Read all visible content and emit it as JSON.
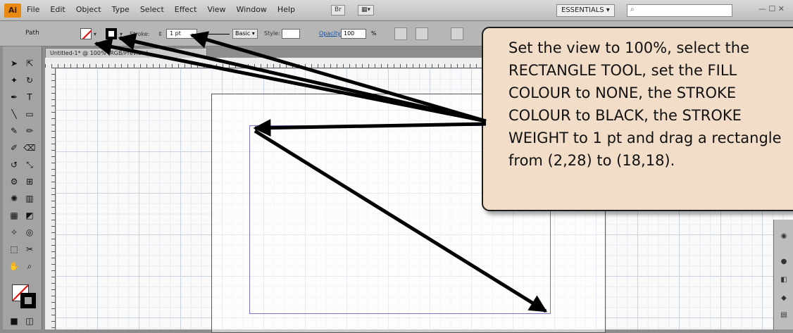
{
  "menu": {
    "items": [
      "File",
      "Edit",
      "Object",
      "Type",
      "Select",
      "Effect",
      "View",
      "Window",
      "Help"
    ],
    "mode_box": "Br",
    "arrange_box": "▦▾",
    "workspace": "ESSENTIALS ▾",
    "window_controls": "— ☐ ✕"
  },
  "control_bar": {
    "selection_label": "Path",
    "stroke_label": "Stroke:",
    "stroke_weight": "1 pt",
    "brush_definition": "Basic ▾",
    "style_label": "Style:",
    "opacity_label": "Opacity:",
    "opacity_value": "100",
    "opacity_unit": "%"
  },
  "document": {
    "tab_title": "Untitled-1* @ 100% (RGB/Preview)"
  },
  "callout": {
    "lines": [
      "Set the view to 100%, select the",
      "RECTANGLE TOOL, set the FILL",
      "COLOUR to NONE, the STROKE",
      "COLOUR to BLACK, the STROKE",
      "WEIGHT to 1 pt and drag a rectangle",
      "from (2,28) to (18,18)."
    ]
  },
  "colors": {
    "callout_fill": "#f2ddc8",
    "callout_border": "#1d1d1d",
    "rectangle_stroke": "#7a74c8",
    "arrow": "#000000",
    "fill_none_slash": "#e00000"
  },
  "icons": {
    "fill_swatch": "fill-none-swatch-icon",
    "stroke_swatch": "stroke-black-swatch-icon",
    "app_logo": "illustrator-logo-icon"
  }
}
